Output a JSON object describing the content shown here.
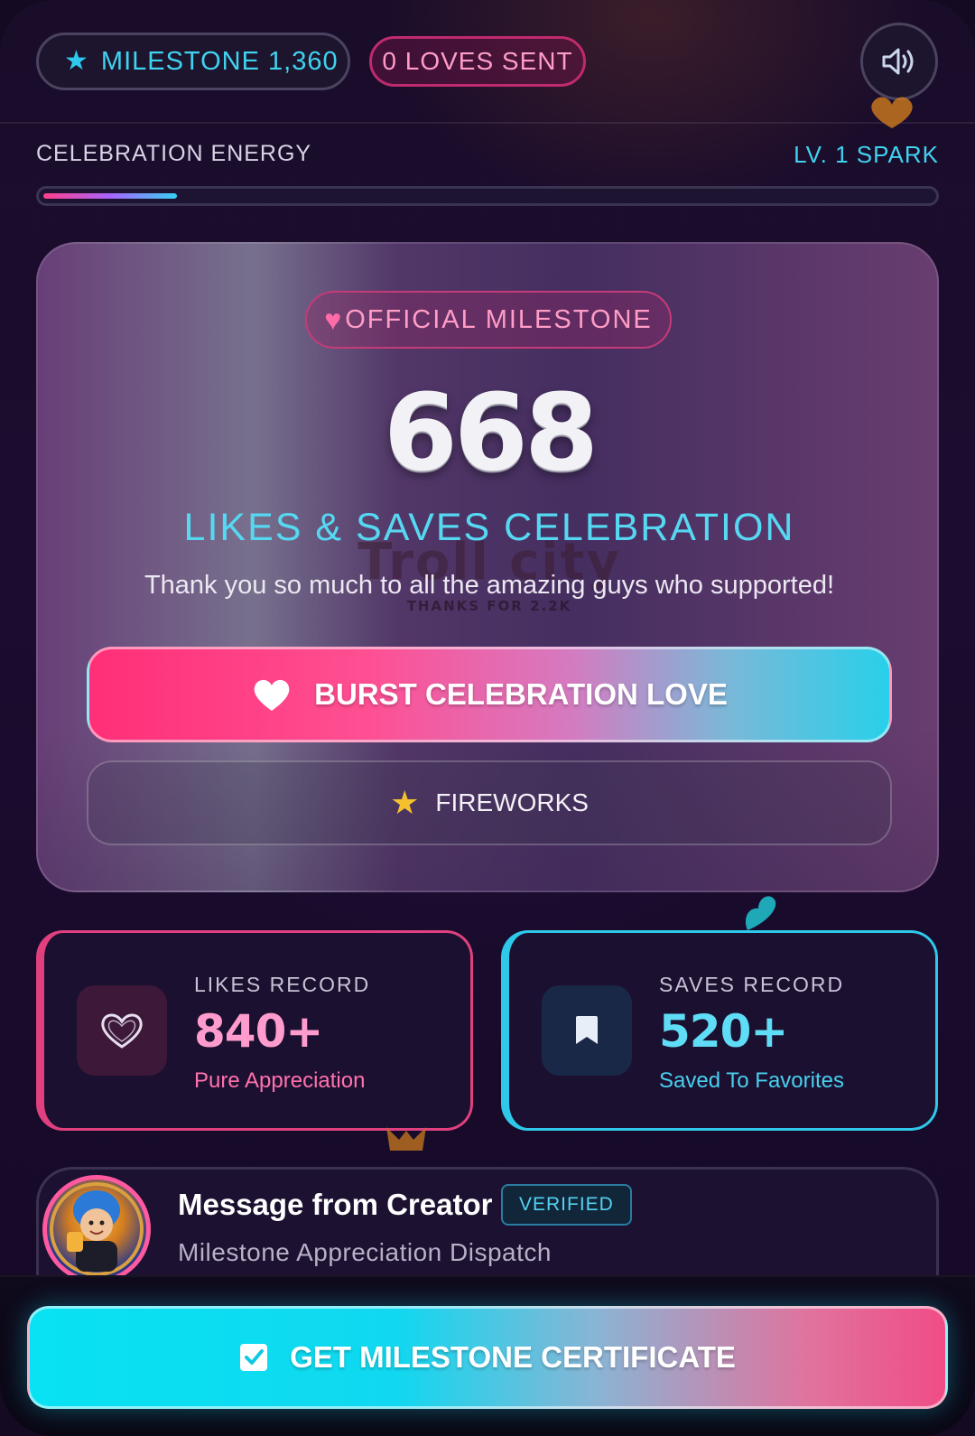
{
  "header": {
    "milestone_label": "MILESTONE 1,360",
    "loves_label": "0 LOVES SENT",
    "icons": {
      "milestone": "star-icon",
      "sound": "speaker-icon"
    }
  },
  "energy": {
    "label": "CELEBRATION ENERGY",
    "level": "LV. 1 SPARK",
    "progress_fraction": 0.15,
    "colors": {
      "start": "#ff3f8a",
      "mid": "#a964ff",
      "end": "#36d0f2"
    }
  },
  "main": {
    "badge": "OFFICIAL MILESTONE",
    "count": "668",
    "title": "LIKES & SAVES CELEBRATION",
    "watermark": "Troll city",
    "watermark_sub": "THANKS FOR 2.2K",
    "thanks": "Thank you so much to all the amazing guys who supported!",
    "burst_button": "BURST CELEBRATION LOVE",
    "fireworks_button": "FIREWORKS"
  },
  "records": {
    "likes": {
      "header": "LIKES RECORD",
      "value": "840+",
      "sub": "Pure Appreciation",
      "icon": "heart-outline-icon",
      "color": "#e0407f"
    },
    "saves": {
      "header": "SAVES RECORD",
      "value": "520+",
      "sub": "Saved To Favorites",
      "icon": "bookmark-icon",
      "color": "#2fc8ea"
    }
  },
  "creator": {
    "title": "Message from Creator",
    "badge": "VERIFIED",
    "subtitle": "Milestone Appreciation Dispatch"
  },
  "footer": {
    "certificate_button": "GET MILESTONE CERTIFICATE",
    "icon": "checkbox-icon"
  }
}
